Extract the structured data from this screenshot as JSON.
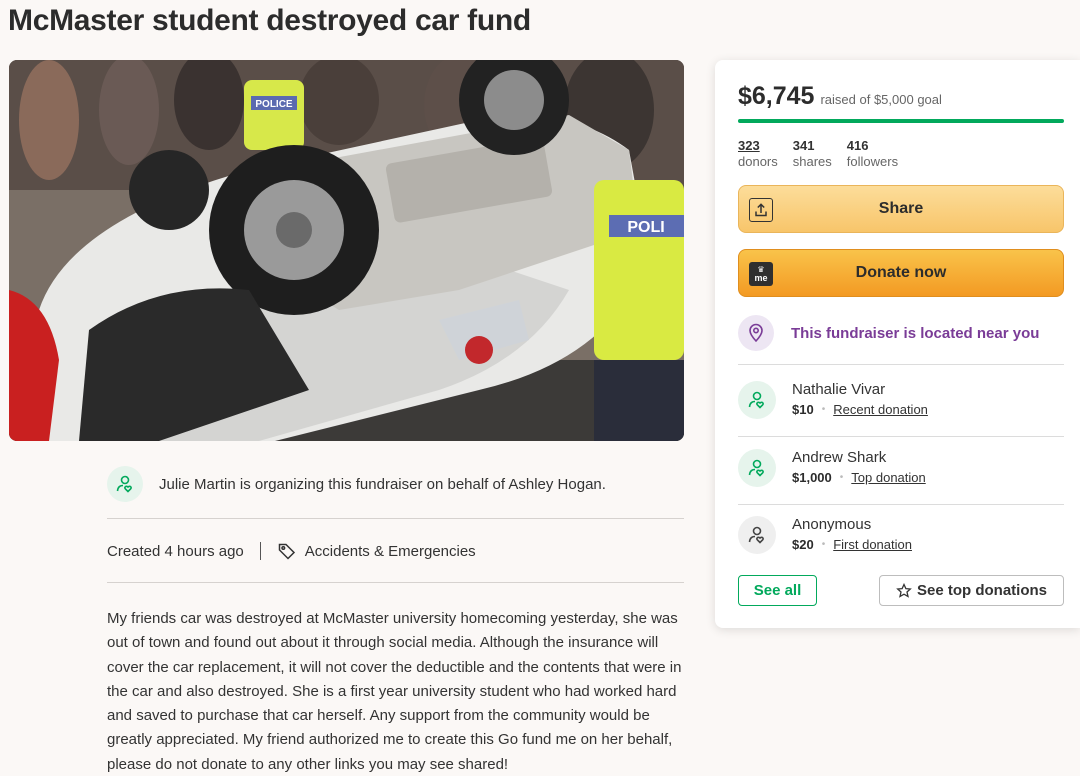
{
  "page": {
    "title": "McMaster student destroyed car fund"
  },
  "organizer": {
    "text": "Julie Martin is organizing this fundraiser on behalf of Ashley Hogan."
  },
  "meta": {
    "created": "Created 4 hours ago",
    "category": "Accidents & Emergencies"
  },
  "story": "My friends car was destroyed at McMaster university homecoming yesterday, she was out of town and found out about it through social media. Although the insurance will cover the car replacement, it will not cover the deductible and the contents that were in the car and also destroyed. She is a first year university student who had worked hard and saved to purchase that car herself. Any support from the community would be greatly appreciated. My friend authorized me to create this Go fund me on her behalf, please do not donate to any other links you may see shared!",
  "card": {
    "raised_amount": "$6,745",
    "goal_text": "raised of $5,000 goal",
    "progress_fraction": 1.0,
    "stats": [
      {
        "value": "323",
        "label": "donors"
      },
      {
        "value": "341",
        "label": "shares"
      },
      {
        "value": "416",
        "label": "followers"
      }
    ],
    "share_label": "Share",
    "donate_label": "Donate now",
    "donate_icon_text": "me",
    "located_text": "This fundraiser is located near you",
    "donations": [
      {
        "name": "Nathalie Vivar",
        "amount": "$10",
        "type": "Recent donation"
      },
      {
        "name": "Andrew Shark",
        "amount": "$1,000",
        "type": "Top donation"
      },
      {
        "name": "Anonymous",
        "amount": "$20",
        "type": "First donation"
      }
    ],
    "see_all_label": "See all",
    "see_top_label": "See top donations"
  },
  "photo_text": {
    "police_1": "POLICE",
    "police_2": "POLI"
  },
  "colors": {
    "accent_green": "#02a95c",
    "share_button": "#f8c56a",
    "donate_button": "#f39a23",
    "location_purple": "#7a3c97"
  },
  "icons": {
    "organizer": "user-heart-icon",
    "category": "tag-icon",
    "share": "share-upload-icon",
    "donate": "gofundme-logo-icon",
    "location": "location-pin-icon",
    "donor": "user-heart-icon",
    "star": "star-outline-icon"
  }
}
